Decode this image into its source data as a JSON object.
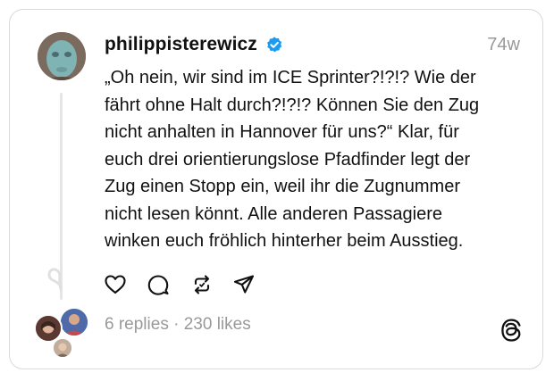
{
  "post": {
    "username": "philippisterewicz",
    "timestamp": "74w",
    "lines": [
      "„Oh nein, wir sind im ICE Sprinter?!?!? Wie der",
      "fährt ohne Halt durch?!?!? Können Sie den Zug",
      "nicht anhalten in Hannover für uns?“ Klar, für",
      "euch drei orientierungslose Pfadfinder legt der",
      "Zug einen Stopp ein, weil ihr die Zugnummer",
      "nicht lesen könnt. Alle anderen Passagiere",
      "winken euch fröhlich hinterher beim Ausstieg."
    ]
  },
  "stats": {
    "replies": "6 replies",
    "separator": " · ",
    "likes": "230 likes"
  },
  "icons": {
    "like": "heart-icon",
    "reply": "comment-icon",
    "repost": "repost-icon",
    "share": "send-icon",
    "verified": "verified-badge-icon",
    "brand": "threads-logo-icon"
  },
  "colors": {
    "verified": "#1d9bf0",
    "muted": "#999999",
    "text": "#111111"
  }
}
